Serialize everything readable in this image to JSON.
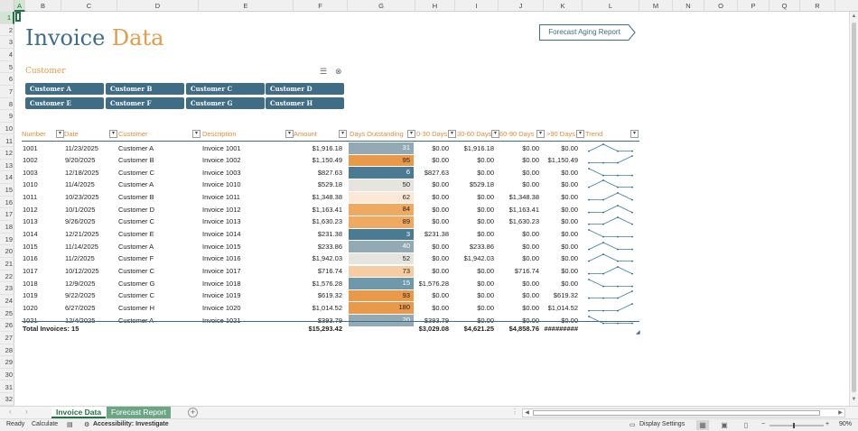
{
  "title": {
    "part1": "Invoice",
    "part2": "Data"
  },
  "aging_button": "Forecast Aging Report",
  "columns": [
    "A",
    "B",
    "C",
    "D",
    "E",
    "F",
    "G",
    "H",
    "I",
    "J",
    "K",
    "L",
    "M",
    "N",
    "O",
    "P",
    "Q",
    "R"
  ],
  "rows": [
    "1",
    "2",
    "3",
    "4",
    "5",
    "6",
    "7",
    "8",
    "9",
    "10",
    "11",
    "12",
    "13",
    "14",
    "15",
    "16",
    "17",
    "18",
    "19",
    "20",
    "21",
    "22",
    "23",
    "24",
    "25",
    "26",
    "27",
    "28",
    "29",
    "30",
    "31",
    "32"
  ],
  "slicer": {
    "caption": "Customer",
    "buttons": [
      "Customer A",
      "Customer B",
      "Customer C",
      "Customer D",
      "Customer E",
      "Customer F",
      "Customer G",
      "Customer H"
    ]
  },
  "headers": [
    "Number",
    "Date",
    "Customer",
    "Description",
    "Amount",
    "Days Outstanding",
    "0-30 Days",
    "30-60 Days",
    "60-90 Days",
    ">90 Days",
    "Trend"
  ],
  "filter_glyph": "▾",
  "invoices": [
    {
      "number": "1001",
      "date": "11/23/2025",
      "customer": "Customer A",
      "description": "Invoice 1001",
      "amount": "$1,916.18",
      "days": 31,
      "d0_30": "$0.00",
      "d30_60": "$1,916.18",
      "d60_90": "$0.00",
      "d90": "$0.00",
      "trend": [
        0,
        1,
        0,
        0
      ]
    },
    {
      "number": "1002",
      "date": "9/20/2025",
      "customer": "Customer B",
      "description": "Invoice 1002",
      "amount": "$1,150.49",
      "days": 95,
      "d0_30": "$0.00",
      "d30_60": "$0.00",
      "d60_90": "$0.00",
      "d90": "$1,150.49",
      "trend": [
        0,
        0,
        0,
        1
      ]
    },
    {
      "number": "1003",
      "date": "12/18/2025",
      "customer": "Customer C",
      "description": "Invoice 1003",
      "amount": "$827.63",
      "days": 6,
      "d0_30": "$827.63",
      "d30_60": "$0.00",
      "d60_90": "$0.00",
      "d90": "$0.00",
      "trend": [
        1,
        0,
        0,
        0
      ]
    },
    {
      "number": "1010",
      "date": "11/4/2025",
      "customer": "Customer A",
      "description": "Invoice 1010",
      "amount": "$529.18",
      "days": 50,
      "d0_30": "$0.00",
      "d30_60": "$529.18",
      "d60_90": "$0.00",
      "d90": "$0.00",
      "trend": [
        0,
        1,
        0,
        0
      ]
    },
    {
      "number": "1011",
      "date": "10/23/2025",
      "customer": "Customer B",
      "description": "Invoice 1011",
      "amount": "$1,348.38",
      "days": 62,
      "d0_30": "$0.00",
      "d30_60": "$0.00",
      "d60_90": "$1,348.38",
      "d90": "$0.00",
      "trend": [
        0,
        0,
        1,
        0
      ]
    },
    {
      "number": "1012",
      "date": "10/1/2025",
      "customer": "Customer D",
      "description": "Invoice 1012",
      "amount": "$1,163.41",
      "days": 84,
      "d0_30": "$0.00",
      "d30_60": "$0.00",
      "d60_90": "$1,163.41",
      "d90": "$0.00",
      "trend": [
        0,
        0,
        1,
        0
      ]
    },
    {
      "number": "1013",
      "date": "9/26/2025",
      "customer": "Customer C",
      "description": "Invoice 1013",
      "amount": "$1,630.23",
      "days": 89,
      "d0_30": "$0.00",
      "d30_60": "$0.00",
      "d60_90": "$1,630.23",
      "d90": "$0.00",
      "trend": [
        0,
        0,
        1,
        0
      ]
    },
    {
      "number": "1014",
      "date": "12/21/2025",
      "customer": "Customer E",
      "description": "Invoice 1014",
      "amount": "$231.38",
      "days": 3,
      "d0_30": "$231.38",
      "d30_60": "$0.00",
      "d60_90": "$0.00",
      "d90": "$0.00",
      "trend": [
        1,
        0,
        0,
        0
      ]
    },
    {
      "number": "1015",
      "date": "11/14/2025",
      "customer": "Customer A",
      "description": "Invoice 1015",
      "amount": "$233.86",
      "days": 40,
      "d0_30": "$0.00",
      "d30_60": "$233.86",
      "d60_90": "$0.00",
      "d90": "$0.00",
      "trend": [
        0,
        1,
        0,
        0
      ]
    },
    {
      "number": "1016",
      "date": "11/2/2025",
      "customer": "Customer F",
      "description": "Invoice 1016",
      "amount": "$1,942.03",
      "days": 52,
      "d0_30": "$0.00",
      "d30_60": "$1,942.03",
      "d60_90": "$0.00",
      "d90": "$0.00",
      "trend": [
        0,
        1,
        0,
        0
      ]
    },
    {
      "number": "1017",
      "date": "10/12/2025",
      "customer": "Customer C",
      "description": "Invoice 1017",
      "amount": "$716.74",
      "days": 73,
      "d0_30": "$0.00",
      "d30_60": "$0.00",
      "d60_90": "$716.74",
      "d90": "$0.00",
      "trend": [
        0,
        0,
        1,
        0
      ]
    },
    {
      "number": "1018",
      "date": "12/9/2025",
      "customer": "Customer G",
      "description": "Invoice 1018",
      "amount": "$1,576.28",
      "days": 15,
      "d0_30": "$1,576.28",
      "d30_60": "$0.00",
      "d60_90": "$0.00",
      "d90": "$0.00",
      "trend": [
        1,
        0,
        0,
        0
      ]
    },
    {
      "number": "1019",
      "date": "9/22/2025",
      "customer": "Customer C",
      "description": "Invoice 1019",
      "amount": "$619.32",
      "days": 93,
      "d0_30": "$0.00",
      "d30_60": "$0.00",
      "d60_90": "$0.00",
      "d90": "$619.32",
      "trend": [
        0,
        0,
        0,
        1
      ]
    },
    {
      "number": "1020",
      "date": "6/27/2025",
      "customer": "Customer H",
      "description": "Invoice 1020",
      "amount": "$1,014.52",
      "days": 180,
      "d0_30": "$0.00",
      "d30_60": "$0.00",
      "d60_90": "$0.00",
      "d90": "$1,014.52",
      "trend": [
        0,
        0,
        0,
        1
      ]
    },
    {
      "number": "1021",
      "date": "12/4/2025",
      "customer": "Customer A",
      "description": "Invoice 1021",
      "amount": "$393.79",
      "days": 20,
      "d0_30": "$393.79",
      "d30_60": "$0.00",
      "d60_90": "$0.00",
      "d90": "$0.00",
      "trend": [
        1,
        0,
        0,
        0
      ]
    }
  ],
  "totals": {
    "label": "Total Invoices: 15",
    "amount": "$15,293.42",
    "d0_30": "$3,029.08",
    "d30_60": "$4,621.25",
    "d60_90": "$4,858.76",
    "d90": "#########"
  },
  "days_colors": {
    "dark_teal": "#4a7b93",
    "mid_teal": "#6f98ab",
    "gray_blue": "#93a9b4",
    "light_gray": "#e6e4df",
    "light_peach": "#fbe8d6",
    "mid_peach": "#f6cda3",
    "orange": "#eeaa63",
    "dark_orange": "#e9994a"
  },
  "accent": {
    "brand_teal": "#3e6d86",
    "header_orange": "#e08d36",
    "excel_green": "#217346"
  },
  "sheet_tabs": [
    "Invoice Data",
    "Forecast Report"
  ],
  "status": {
    "ready": "Ready",
    "calculate": "Calculate",
    "accessibility": "Accessibility: Investigate",
    "display_settings": "Display Settings",
    "zoom": "90%"
  }
}
